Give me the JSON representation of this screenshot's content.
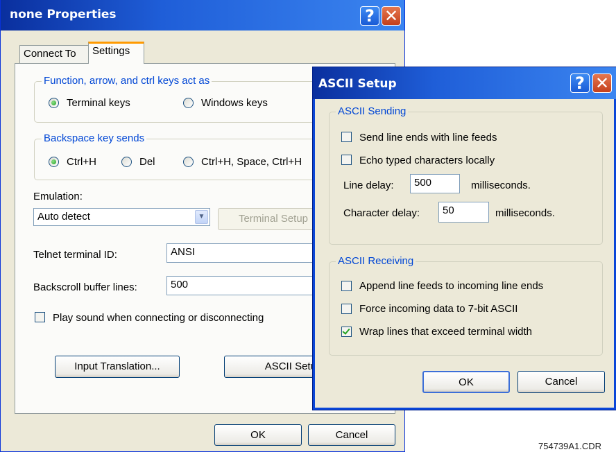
{
  "main_dialog": {
    "title": "none Properties",
    "tabs": [
      {
        "label": "Connect To"
      },
      {
        "label": "Settings"
      }
    ],
    "function_keys_group": {
      "title": "Function, arrow, and ctrl keys act as",
      "options": [
        "Terminal keys",
        "Windows keys"
      ],
      "selected": "Terminal keys"
    },
    "backspace_group": {
      "title": "Backspace key sends",
      "options": [
        "Ctrl+H",
        "Del",
        "Ctrl+H, Space, Ctrl+H"
      ],
      "selected": "Ctrl+H"
    },
    "emulation": {
      "label": "Emulation:",
      "value": "Auto detect"
    },
    "terminal_setup_button": "Terminal Setup",
    "telnet_id": {
      "label": "Telnet terminal ID:",
      "value": "ANSI"
    },
    "backscroll": {
      "label": "Backscroll buffer lines:",
      "value": "500"
    },
    "play_sound": {
      "label": "Play sound when connecting or disconnecting",
      "checked": false
    },
    "input_translation_button": "Input Translation...",
    "ascii_setup_button": "ASCII Setup",
    "ok_button": "OK",
    "cancel_button": "Cancel"
  },
  "ascii_dialog": {
    "title": "ASCII Setup",
    "sending_group": {
      "title": "ASCII Sending",
      "send_line_ends": {
        "label": "Send line ends with line feeds",
        "checked": false
      },
      "echo_typed": {
        "label": "Echo typed characters locally",
        "checked": false
      },
      "line_delay": {
        "label": "Line delay:",
        "value": "500",
        "unit": "milliseconds."
      },
      "char_delay": {
        "label": "Character delay:",
        "value": "50",
        "unit": "milliseconds."
      }
    },
    "receiving_group": {
      "title": "ASCII Receiving",
      "append_line_feeds": {
        "label": "Append line feeds to incoming line ends",
        "checked": false
      },
      "force_7bit": {
        "label": "Force incoming data to 7-bit ASCII",
        "checked": false
      },
      "wrap_lines": {
        "label": "Wrap lines that exceed terminal width",
        "checked": true
      }
    },
    "ok_button": "OK",
    "cancel_button": "Cancel"
  },
  "figure_code": "754739A1.CDR",
  "colors": {
    "titlebar_start": "#0a246a",
    "titlebar_end": "#3a81f3",
    "dialog_bg": "#ece9d8",
    "group_title": "#0046d5"
  }
}
